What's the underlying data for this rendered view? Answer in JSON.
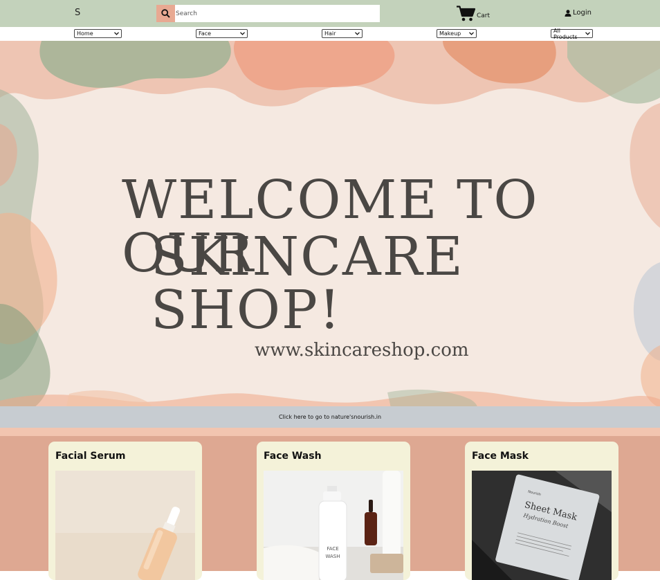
{
  "header": {
    "logo": "S",
    "search": {
      "placeholder": "Search",
      "value": ""
    },
    "cart_label": "Cart",
    "login_label": "Login"
  },
  "nav": {
    "items": [
      {
        "label": "Home"
      },
      {
        "label": "Face"
      },
      {
        "label": "Hair"
      },
      {
        "label": "Makeup"
      },
      {
        "label": "All Products"
      }
    ]
  },
  "hero": {
    "line1": "WELCOME TO OUR",
    "line2": "SKINCARE SHOP!",
    "url": "www.skincareshop.com",
    "link_text": "Click here to go to nature'snourish.in"
  },
  "products": [
    {
      "title": "Facial Serum"
    },
    {
      "title": "Face Wash"
    },
    {
      "title": "Face Mask"
    }
  ],
  "images": {
    "face_wash_bottle_text": "FACE WASH",
    "sheet_mask_title": "Sheet Mask",
    "sheet_mask_subtitle": "Hydration Boost",
    "sheet_mask_brand": "Nourish"
  },
  "colors": {
    "topbar": "#c3d2bb",
    "search_button": "#e8a992",
    "hero_bg": "#f5e9e1",
    "hero_text": "#4a4744",
    "link_bar": "#c7ccd1",
    "products_bg": "#dea892",
    "card_bg": "#f4f2d9"
  }
}
